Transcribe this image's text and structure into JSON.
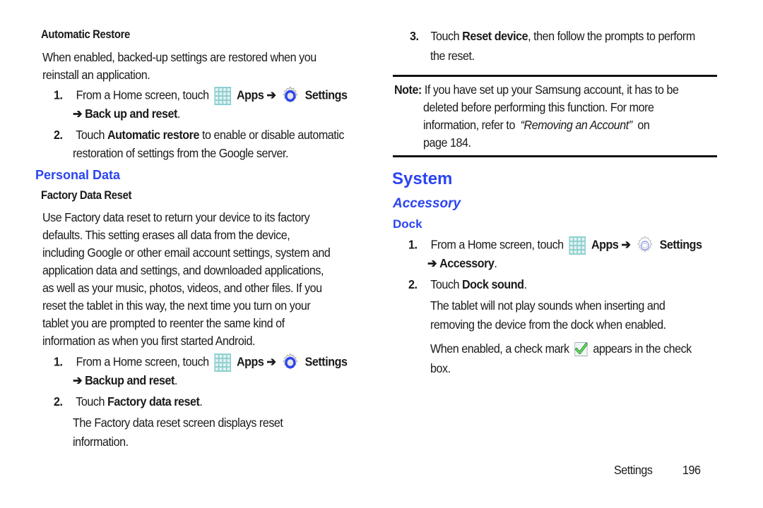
{
  "left": {
    "automatic_restore": {
      "heading": "Automatic Restore",
      "intro_line1": "When enabled, backed-up settings are restored when you",
      "intro_line2": "reinstall an application.",
      "step1": {
        "num": "1.",
        "pre": "From a Home screen, touch",
        "apps": "Apps",
        "arrow": "➔",
        "settings": "Settings",
        "line2_arrow": "➔",
        "line2_bold": "Back up and reset",
        "line2_end": "."
      },
      "step2": {
        "num": "2.",
        "pre": "Touch",
        "bold": "Automatic restore",
        "post": "to enable or disable automatic",
        "line2": "restoration of settings from the Google server."
      }
    },
    "personal_data": {
      "heading": "Personal Data",
      "subheading": "Factory Data Reset",
      "para_lines": [
        "Use Factory data reset to return your device to its factory",
        "defaults. This setting erases all data from the device,",
        "including Google or other email account settings, system and",
        "application data and settings, and downloaded applications,",
        "as well as your music, photos, videos, and other files. If you",
        "reset the tablet in this way, the next time you turn on your",
        "tablet you are prompted to reenter the same kind of",
        "information as when you first started Android."
      ],
      "step1": {
        "num": "1.",
        "pre": "From a Home screen, touch",
        "apps": "Apps",
        "arrow": "➔",
        "settings": "Settings",
        "line2_arrow": "➔",
        "line2_bold": "Backup and reset",
        "line2_end": "."
      },
      "step2": {
        "num": "2.",
        "pre": "Touch",
        "bold": "Factory data reset",
        "end": "."
      },
      "result_line1": "The Factory data reset screen displays reset",
      "result_line2": "information."
    }
  },
  "right": {
    "step3": {
      "num": "3.",
      "pre": "Touch",
      "bold": "Reset device",
      "post": ", then follow the prompts to perform",
      "line2": "the reset."
    },
    "note": {
      "label": "Note:",
      "line1": "If you have set up your Samsung account, it has to be",
      "line2": "deleted before performing this function. For more",
      "line3_pre": "information, refer to",
      "line3_italic": "“Removing an Account”",
      "line3_post": "on",
      "line4": "page 184."
    },
    "system": {
      "heading": "System",
      "subheading": "Accessory",
      "section": "Dock",
      "step1": {
        "num": "1.",
        "pre": "From a Home screen, touch",
        "apps": "Apps",
        "arrow": "➔",
        "settings": "Settings",
        "line2_arrow": "➔",
        "line2_bold": "Accessory",
        "line2_end": "."
      },
      "step2": {
        "num": "2.",
        "pre": "Touch",
        "bold": "Dock sound",
        "end": "."
      },
      "desc_line1": "The tablet will not play sounds when inserting and",
      "desc_line2": "removing the device from the dock when enabled.",
      "check_pre": "When enabled, a check mark",
      "check_post": "appears in the check",
      "check_line2": "box."
    }
  },
  "footer": {
    "section": "Settings",
    "page": "196"
  },
  "colors": {
    "heading_blue": "#2b44f0",
    "apps_icon": "#8fcfcf",
    "gear_blue": "#2b44f0",
    "check_green": "#2fbf2f"
  }
}
